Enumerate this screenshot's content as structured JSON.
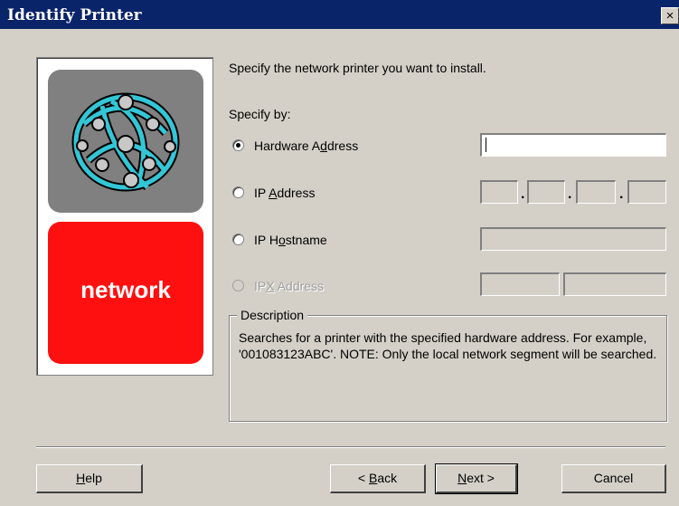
{
  "window": {
    "title": "Identify Printer",
    "close_glyph": "×"
  },
  "logo": {
    "word": "network",
    "icon": "network-globe-icon",
    "colors": {
      "top": "#808080",
      "bottom": "#ff1010",
      "globe": "#33c6d6"
    }
  },
  "instructions": "Specify the network printer you want to install.",
  "specify_by_label": "Specify by:",
  "options": {
    "hardware": {
      "pre": "Hardware A",
      "accel": "d",
      "post": "dress",
      "selected": true,
      "enabled": true,
      "value": ""
    },
    "ip_address": {
      "pre": "IP ",
      "accel": "A",
      "post": "ddress",
      "selected": false,
      "enabled": true,
      "octets": [
        "",
        "",
        "",
        ""
      ],
      "separator": "."
    },
    "ip_hostname": {
      "pre": "IP H",
      "accel": "o",
      "post": "stname",
      "selected": false,
      "enabled": true,
      "value": ""
    },
    "ipx_address": {
      "pre": "IP",
      "accel": "X",
      "post": " Address",
      "selected": false,
      "enabled": false,
      "values": [
        "",
        ""
      ]
    }
  },
  "description": {
    "label": "Description",
    "text": "Searches for a printer with the specified hardware address. For example, '001083123ABC'.  NOTE: Only the local network segment will be searched."
  },
  "buttons": {
    "help": {
      "accel": "H",
      "rest": "elp"
    },
    "back": {
      "pre": "< ",
      "accel": "B",
      "post": "ack"
    },
    "next": {
      "pre": "",
      "accel": "N",
      "post": "ext >"
    },
    "cancel": "Cancel"
  }
}
